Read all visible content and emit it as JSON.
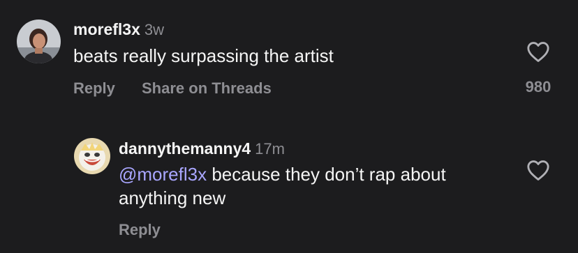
{
  "comments": [
    {
      "username": "morefl3x",
      "time": "3w",
      "text": "beats really surpassing the artist",
      "actions": {
        "reply": "Reply",
        "share": "Share on Threads"
      },
      "likes": "980",
      "avatar_icon": "profile-photo"
    },
    {
      "username": "dannythemanny4",
      "time": "17m",
      "mention": "@morefl3x",
      "text": " because they don’t rap about anything new",
      "actions": {
        "reply": "Reply"
      },
      "avatar_icon": "profile-photo"
    }
  ],
  "colors": {
    "background": "#1c1c1e",
    "text": "#f5f5f5",
    "muted": "#8e8e93",
    "mention": "#a9a6ff"
  }
}
